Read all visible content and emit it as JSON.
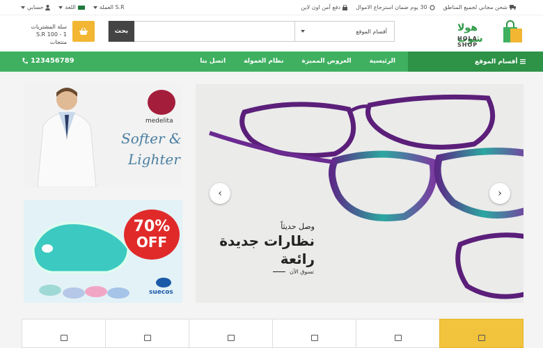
{
  "topbar": {
    "shipping": "شحن مجاني لجميع المناطق",
    "returns": "30 يوم ضمان استرجاع الاموال",
    "payment": "دفع آمن اون لاين",
    "currency": "العملة S.R",
    "language": "اللغة",
    "account": "حسابي"
  },
  "header": {
    "logo_ar": "هولا شوب",
    "logo_en": "HOLA SHOP",
    "search_button": "بحث",
    "search_placeholder": "",
    "category_select": "أقسام الموقع",
    "cart_title": "سلة المشتريات",
    "cart_summary": "S.R 100 - 1 منتجات"
  },
  "nav": {
    "categories": "أقسام الموقع",
    "items": [
      "الرئيسية",
      "العروض المميزة",
      "نظام العمولة",
      "اتصل بنا"
    ],
    "phone": "123456789"
  },
  "banner_top": {
    "brand": "medelita",
    "line1": "Softer &",
    "line2": "Lighter"
  },
  "banner_bottom": {
    "discount": "70%",
    "off": "OFF",
    "brand": "suecos"
  },
  "slider": {
    "subtitle": "وصل حديثاً",
    "title_line1": "نظارات جديدة",
    "title_line2": "رائعة",
    "cta": "تسوق الآن"
  },
  "colors": {
    "green": "#3fb060",
    "dark_green": "#2e9247",
    "accent": "#f2b632"
  }
}
